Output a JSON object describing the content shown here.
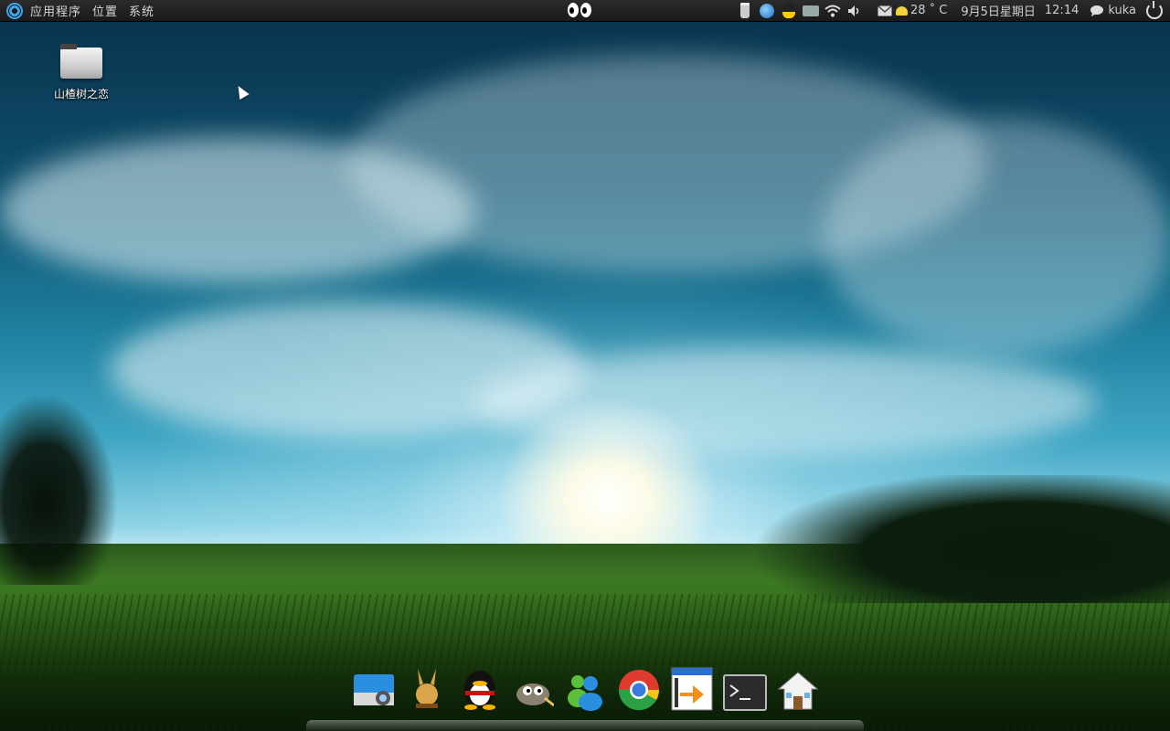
{
  "panel": {
    "menus": [
      "应用程序",
      "位置",
      "系统"
    ],
    "weather_temp": "28 ˚ C",
    "date": "9月5日星期日",
    "time": "12:14",
    "user": "kuka"
  },
  "desktop": {
    "icons": [
      {
        "label": "山楂树之恋",
        "icon": "folder-icon"
      }
    ]
  },
  "dock": {
    "items": [
      {
        "name": "camera-app-icon"
      },
      {
        "name": "emule-icon"
      },
      {
        "name": "qq-icon"
      },
      {
        "name": "gimp-icon"
      },
      {
        "name": "messenger-icon"
      },
      {
        "name": "chrome-icon"
      },
      {
        "name": "window-switcher-icon"
      },
      {
        "name": "terminal-icon"
      },
      {
        "name": "home-icon"
      }
    ]
  },
  "colors": {
    "panel_bg": "#1f1f1f",
    "panel_text": "#d6d6d6",
    "accent_blue": "#3aa6e8"
  }
}
